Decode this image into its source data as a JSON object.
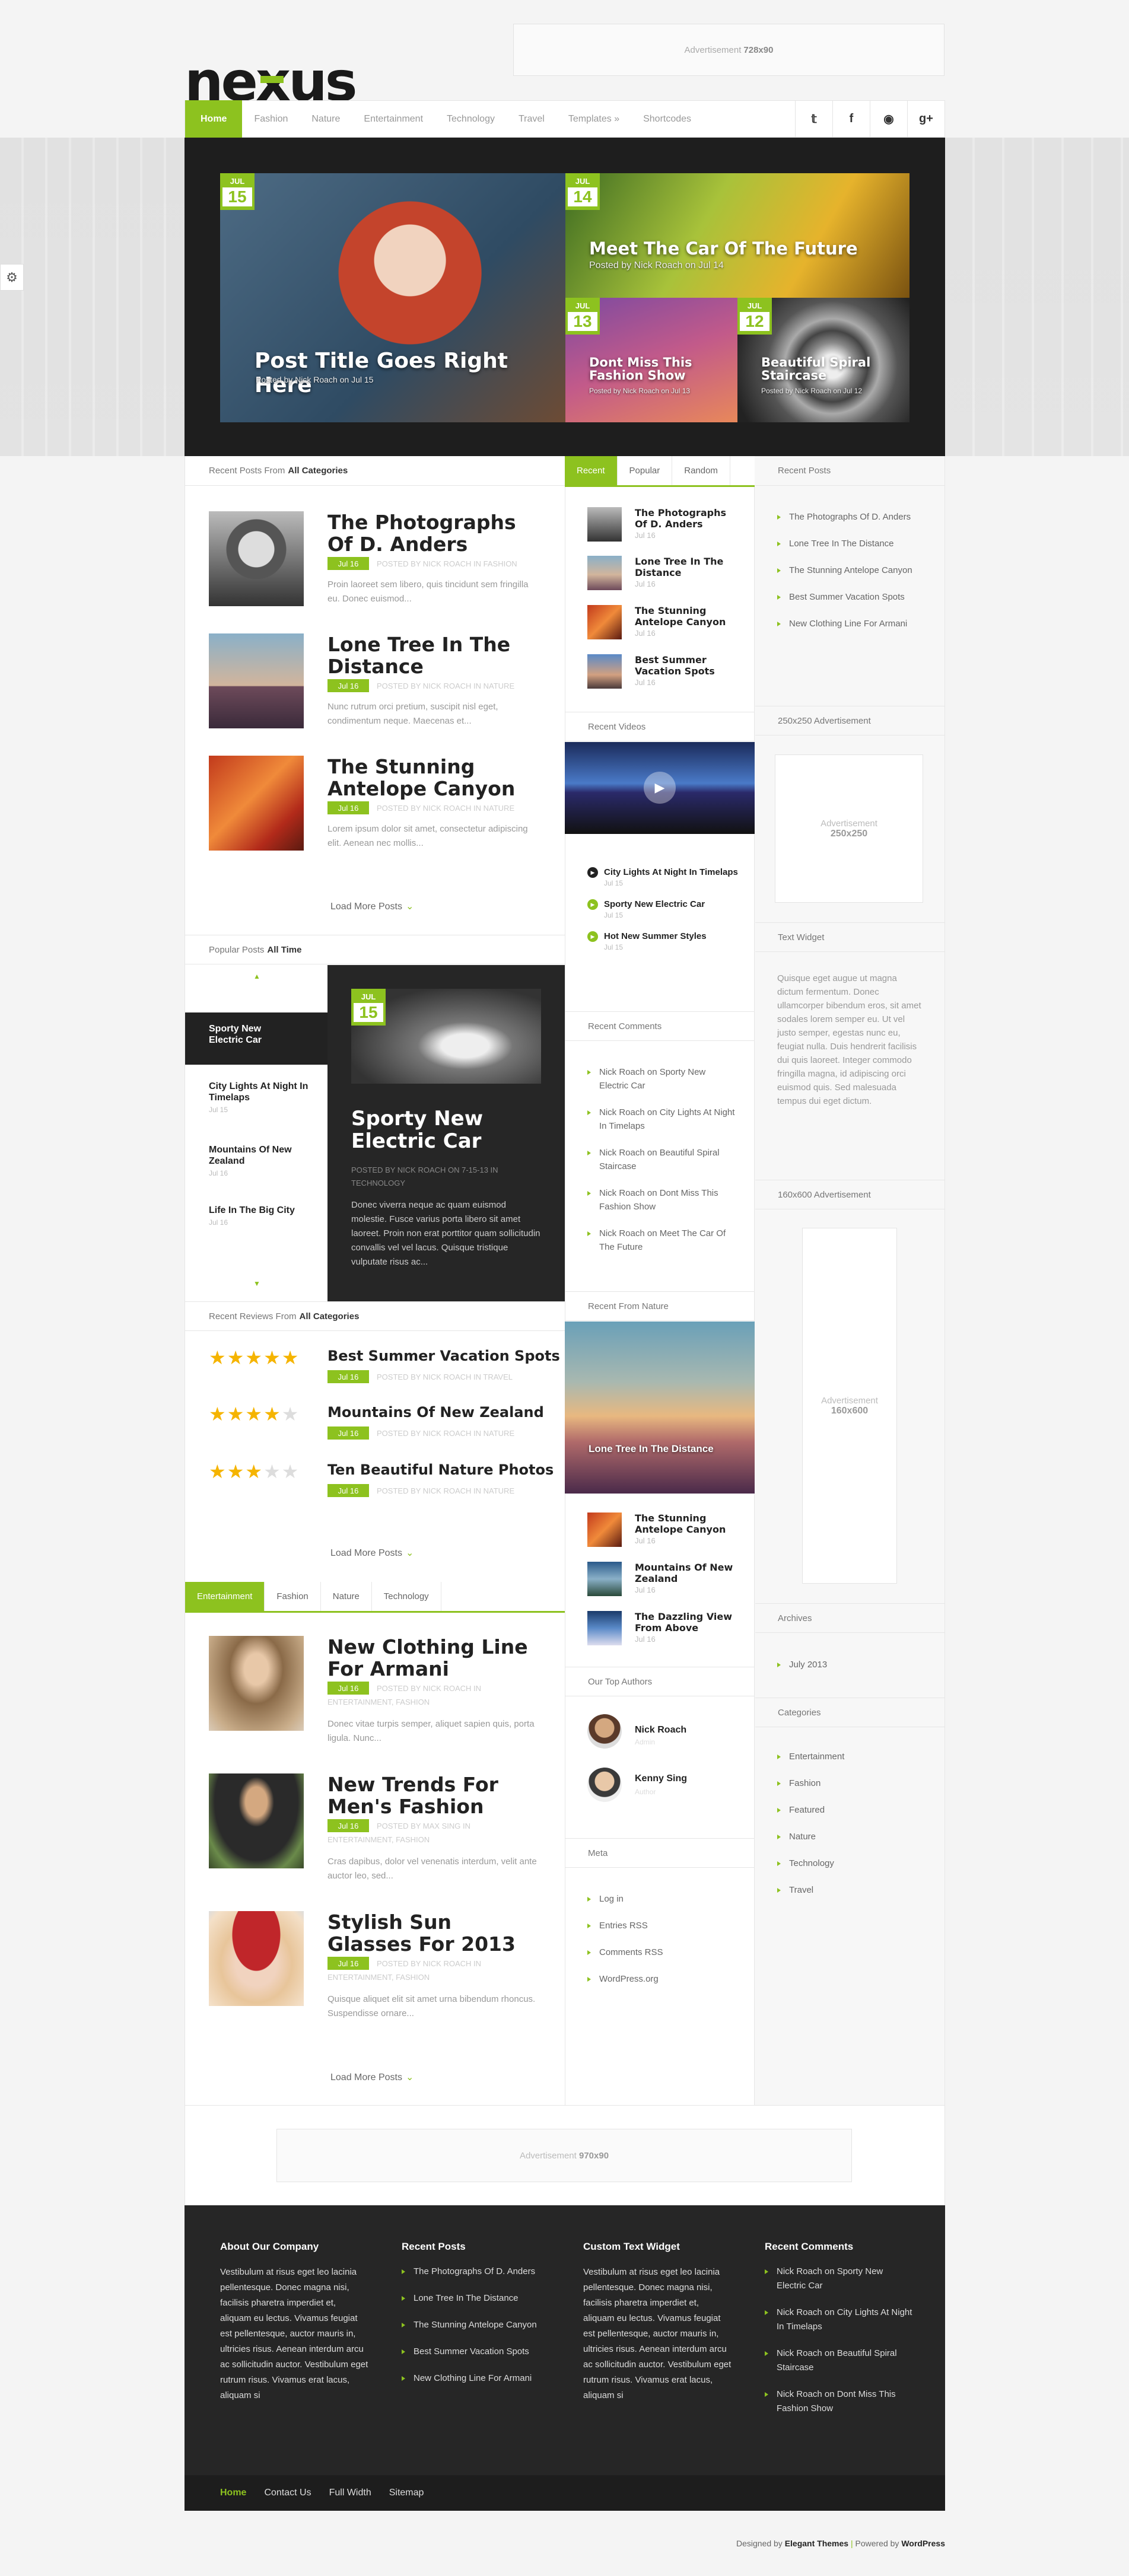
{
  "ad_top": {
    "label": "Advertisement",
    "size": "728x90"
  },
  "logo": {
    "text": "nexus"
  },
  "nav": {
    "items": [
      "Home",
      "Fashion",
      "Nature",
      "Entertainment",
      "Technology",
      "Travel",
      "Templates »",
      "Shortcodes"
    ],
    "social": [
      "t",
      "f",
      "rss",
      "g+"
    ]
  },
  "slider": {
    "main": {
      "month": "JUL",
      "day": "15",
      "title": "Post Title Goes Right Here",
      "meta": "Posted by Nick Roach on Jul 15"
    },
    "top_right": {
      "month": "JUL",
      "day": "14",
      "title": "Meet The Car Of The Future",
      "meta": "Posted by Nick Roach on Jul 14"
    },
    "bottom_left": {
      "month": "JUL",
      "day": "13",
      "title": "Dont Miss This Fashion Show",
      "meta": "Posted by Nick Roach on Jul 13"
    },
    "bottom_right": {
      "month": "JUL",
      "day": "12",
      "title": "Beautiful Spiral Staircase",
      "meta": "Posted by Nick Roach on Jul 12"
    }
  },
  "recent_posts": {
    "heading": "Recent Posts From",
    "heading_bold": "All Categories",
    "posts": [
      {
        "title": "The Photographs Of D. Anders",
        "date": "Jul 16",
        "by": "POSTED BY NICK ROACH IN FASHION",
        "excerpt": "Proin laoreet sem libero, quis tincidunt sem fringilla eu. Donec euismod..."
      },
      {
        "title": "Lone Tree In The Distance",
        "date": "Jul 16",
        "by": "POSTED BY NICK ROACH IN NATURE",
        "excerpt": "Nunc rutrum orci pretium, suscipit nisl eget, condimentum neque. Maecenas et..."
      },
      {
        "title": "The Stunning Antelope Canyon",
        "date": "Jul 16",
        "by": "POSTED BY NICK ROACH IN NATURE",
        "excerpt": "Lorem ipsum dolor sit amet, consectetur adipiscing elit. Aenean nec mollis..."
      }
    ],
    "load_more": "Load More Posts"
  },
  "popular": {
    "heading": "Popular Posts",
    "heading_bold": "All Time",
    "items": [
      {
        "title": "Sporty New Electric Car",
        "date": "Jul 15"
      },
      {
        "title": "City Lights At Night In Timelaps",
        "date": "Jul 15"
      },
      {
        "title": "Mountains Of New Zealand",
        "date": "Jul 16"
      },
      {
        "title": "Life In The Big City",
        "date": "Jul 16"
      }
    ],
    "featured": {
      "month": "JUL",
      "day": "15",
      "title": "Sporty New Electric Car",
      "by": "POSTED BY NICK ROACH ON 7-15-13 IN TECHNOLOGY",
      "excerpt": "Donec viverra neque ac quam euismod molestie. Fusce varius porta libero sit amet laoreet. Proin non erat porttitor quam sollicitudin convallis vel vel lacus. Quisque tristique vulputate risus ac..."
    }
  },
  "reviews": {
    "heading": "Recent Reviews From",
    "heading_bold": "All Categories",
    "items": [
      {
        "title": "Best Summer Vacation Spots",
        "date": "Jul 16",
        "by": "POSTED BY NICK ROACH IN TRAVEL",
        "stars": 5
      },
      {
        "title": "Mountains Of New Zealand",
        "date": "Jul 16",
        "by": "POSTED BY NICK ROACH IN NATURE",
        "stars": 4
      },
      {
        "title": "Ten Beautiful Nature Photos",
        "date": "Jul 16",
        "by": "POSTED BY NICK ROACH IN NATURE",
        "stars": 3
      }
    ],
    "load_more": "Load More Posts"
  },
  "cat_tabs": {
    "tabs": [
      "Entertainment",
      "Fashion",
      "Nature",
      "Technology"
    ],
    "posts": [
      {
        "title": "New Clothing Line For Armani",
        "date": "Jul 16",
        "by": "POSTED BY NICK ROACH IN",
        "by2": "ENTERTAINMENT, FASHION",
        "excerpt": "Donec vitae turpis semper, aliquet sapien quis, porta ligula. Nunc..."
      },
      {
        "title": "New Trends For Men's Fashion",
        "date": "Jul 16",
        "by": "POSTED BY MAX SING IN",
        "by2": "ENTERTAINMENT, FASHION",
        "excerpt": "Cras dapibus, dolor vel venenatis interdum, velit ante auctor leo, sed..."
      },
      {
        "title": "Stylish Sun Glasses For 2013",
        "date": "Jul 16",
        "by": "POSTED BY NICK ROACH IN",
        "by2": "ENTERTAINMENT, FASHION",
        "excerpt": "Quisque aliquet elit sit amet urna bibendum rhoncus. Suspendisse ornare..."
      }
    ],
    "load_more": "Load More Posts"
  },
  "mid": {
    "tabs": [
      "Recent",
      "Popular",
      "Random"
    ],
    "recent": [
      {
        "title": "The Photographs Of D. Anders",
        "date": "Jul 16"
      },
      {
        "title": "Lone Tree In The Distance",
        "date": "Jul 16"
      },
      {
        "title": "The Stunning Antelope Canyon",
        "date": "Jul 16"
      },
      {
        "title": "Best Summer Vacation Spots",
        "date": "Jul 16"
      }
    ],
    "videos_heading": "Recent Videos",
    "videos": [
      {
        "title": "City Lights At Night In Timelaps",
        "date": "Jul 15"
      },
      {
        "title": "Sporty New Electric Car",
        "date": "Jul 15"
      },
      {
        "title": "Hot New Summer Styles",
        "date": "Jul 15"
      }
    ],
    "comments_heading": "Recent Comments",
    "comments": [
      "Nick Roach on Sporty New Electric Car",
      "Nick Roach on City Lights At Night In Timelaps",
      "Nick Roach on Beautiful Spiral Staircase",
      "Nick Roach on Dont Miss This Fashion Show",
      "Nick Roach on Meet The Car Of The Future"
    ],
    "nature_heading": "Recent From Nature",
    "nature_feature": "Lone Tree In The Distance",
    "nature": [
      {
        "title": "The Stunning Antelope Canyon",
        "date": "Jul 16"
      },
      {
        "title": "Mountains Of New Zealand",
        "date": "Jul 16"
      },
      {
        "title": "The Dazzling View From Above",
        "date": "Jul 16"
      }
    ],
    "authors_heading": "Our Top Authors",
    "authors": [
      {
        "name": "Nick Roach",
        "role": "Admin"
      },
      {
        "name": "Kenny Sing",
        "role": "Author"
      }
    ],
    "meta_heading": "Meta",
    "meta": [
      "Log in",
      "Entries RSS",
      "Comments RSS",
      "WordPress.org"
    ]
  },
  "right": {
    "recent_heading": "Recent Posts",
    "recent": [
      "The Photographs Of D. Anders",
      "Lone Tree In The Distance",
      "The Stunning Antelope Canyon",
      "Best Summer Vacation Spots",
      "New Clothing Line For Armani"
    ],
    "ad250_heading": "250x250 Advertisement",
    "ad250": {
      "label": "Advertisement",
      "size": "250x250"
    },
    "text_heading": "Text Widget",
    "text": "Quisque eget augue ut magna dictum fermentum. Donec ullamcorper bibendum eros, sit amet sodales lorem semper eu. Ut vel justo semper, egestas nunc eu, feugiat nulla. Duis hendrerit facilisis dui quis laoreet. Integer commodo fringilla magna, id adipiscing orci euismod quis. Sed malesuada tempus dui eget dictum.",
    "ad160_heading": "160x600 Advertisement",
    "ad160": {
      "label": "Advertisement",
      "size": "160x600"
    },
    "archives_heading": "Archives",
    "archives": [
      "July 2013"
    ],
    "categories_heading": "Categories",
    "categories": [
      "Entertainment",
      "Fashion",
      "Featured",
      "Nature",
      "Technology",
      "Travel"
    ]
  },
  "ad_bottom": {
    "label": "Advertisement",
    "size": "970x90"
  },
  "footer": {
    "about_heading": "About Our Company",
    "about": "Vestibulum at risus eget leo lacinia pellentesque. Donec magna nisi, facilisis pharetra imperdiet et, aliquam eu lectus. Vivamus feugiat est pellentesque, auctor mauris in, ultricies risus. Aenean interdum arcu ac sollicitudin auctor. Vestibulum eget rutrum risus. Vivamus erat lacus, aliquam si",
    "recent_heading": "Recent Posts",
    "recent": [
      "The Photographs Of D. Anders",
      "Lone Tree In The Distance",
      "The Stunning Antelope Canyon",
      "Best Summer Vacation Spots",
      "New Clothing Line For Armani"
    ],
    "custom_heading": "Custom Text Widget",
    "custom": "Vestibulum at risus eget leo lacinia pellentesque. Donec magna nisi, facilisis pharetra imperdiet et, aliquam eu lectus. Vivamus feugiat est pellentesque, auctor mauris in, ultricies risus. Aenean interdum arcu ac sollicitudin auctor. Vestibulum eget rutrum risus. Vivamus erat lacus, aliquam si",
    "comments_heading": "Recent Comments",
    "comments": [
      "Nick Roach on Sporty New Electric Car",
      "Nick Roach on City Lights At Night In Timelaps",
      "Nick Roach on Beautiful Spiral Staircase",
      "Nick Roach on Dont Miss This Fashion Show"
    ],
    "links": [
      "Home",
      "Contact Us",
      "Full Width",
      "Sitemap"
    ],
    "credit_designed": "Designed by",
    "credit_et": "Elegant Themes",
    "credit_sep": "|",
    "credit_powered": "Powered by",
    "credit_wp": "WordPress"
  },
  "colors": {
    "accent": "#8dc21f",
    "dark": "#262626"
  }
}
